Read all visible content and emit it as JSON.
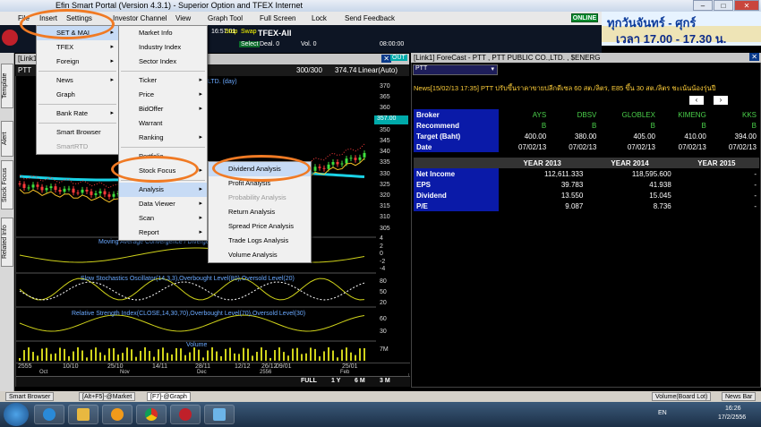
{
  "window": {
    "title": "Efin Smart Portal (Version 4.3.1) - Superior Option and TFEX Internet"
  },
  "menubar": {
    "items": [
      "File",
      "Insert",
      "Settings",
      "Investor Channel",
      "View",
      "Graph Tool",
      "Full Screen",
      "Lock",
      "Send Feedback"
    ],
    "online": "ONLINE"
  },
  "banner": {
    "line1": "ทุกวันจันทร์ - ศุกร์",
    "line2": "เวลา 17.00 - 17.30 น."
  },
  "ticker": {
    "time": "16:57:01",
    "stop": "Stop",
    "swap": "Swap",
    "symbol": "TFEX-All",
    "select": "Select",
    "deal": "Deal. 0",
    "vol": "Vol. 0",
    "clock": "08:00:00"
  },
  "menu_insert": {
    "items": [
      {
        "label": "SET & MAI",
        "arrow": true,
        "selected": true
      },
      {
        "label": "TFEX",
        "arrow": true
      },
      {
        "label": "Foreign",
        "arrow": true
      },
      {
        "label": "News",
        "arrow": true
      },
      {
        "label": "Graph",
        "arrow": false
      },
      {
        "label": "Bank Rate",
        "arrow": true
      },
      {
        "label": "Smart Browser",
        "arrow": false
      },
      {
        "label": "SmartRTD",
        "arrow": false,
        "disabled": true
      }
    ]
  },
  "menu_setmai": {
    "items": [
      {
        "label": "Market Info",
        "arrow": false
      },
      {
        "label": "Industry Index",
        "arrow": false
      },
      {
        "label": "Sector Index",
        "arrow": false
      },
      {
        "label": "Ticker",
        "arrow": true
      },
      {
        "label": "Price",
        "arrow": true
      },
      {
        "label": "BidOffer",
        "arrow": true
      },
      {
        "label": "Warrant",
        "arrow": false
      },
      {
        "label": "Ranking",
        "arrow": true
      },
      {
        "label": "Portfolio",
        "arrow": false
      },
      {
        "label": "Stock Focus",
        "arrow": true
      },
      {
        "label": "Analysis",
        "arrow": true,
        "selected": true
      },
      {
        "label": "Data Viewer",
        "arrow": true
      },
      {
        "label": "Scan",
        "arrow": true
      },
      {
        "label": "Report",
        "arrow": true
      }
    ]
  },
  "menu_analysis": {
    "items": [
      {
        "label": "Dividend Analysis",
        "selected": true
      },
      {
        "label": "Profit Analysis"
      },
      {
        "label": "Probability Analysis",
        "disabled": true
      },
      {
        "label": "Return Analysis"
      },
      {
        "label": "Spread Price Analysis"
      },
      {
        "label": "Trade Logs Analysis"
      },
      {
        "label": "Volume Analysis"
      }
    ]
  },
  "sidetabs": [
    "Template",
    "Alert",
    "Stock Focus",
    "Related Info"
  ],
  "chart": {
    "header": "[Link1]",
    "symbol": "PTT",
    "counter": "300/300",
    "price": "374.74",
    "scale": "Linear(Auto)",
    "title_suffix": "LTD. (day)",
    "out": "OUT",
    "last_price": "357.00",
    "price_ticks": [
      "370",
      "365",
      "360",
      "355",
      "350",
      "345",
      "340",
      "335",
      "330",
      "325",
      "320",
      "315",
      "310",
      "305"
    ],
    "macd_label": "Moving Average Convergence / Divergence",
    "macd_ticks": [
      "4",
      "2",
      "0",
      "-2",
      "-4"
    ],
    "stoch_label": "Slow Stochastics Oscillator(14,3,3),Overbought Level(80),Oversold Level(20)",
    "stoch_ticks": [
      "80",
      "50",
      "20"
    ],
    "rsi_label": "Relative Strength Index(CLOSE,14,30,70),Overbought Level(70),Oversold Level(30)",
    "rsi_ticks": [
      "60",
      "30"
    ],
    "volume_label": "Volume",
    "volume_tick": "7M",
    "dates_top": [
      "2555",
      "10/10",
      "25/10",
      "14/11",
      "28/11",
      "12/12",
      "26/12",
      "09/01",
      "25/01"
    ],
    "dates_bottom": [
      "Oct",
      "Nov",
      "Dec",
      "2556",
      "Feb"
    ],
    "periods": [
      "FULL",
      "1 Y",
      "6 M",
      "3 M"
    ]
  },
  "forecast": {
    "header": "[Link1] ForeCast - PTT , PTT PUBLIC CO.,LTD. , $ENERG",
    "symbol": "PTT",
    "news": "News[15/02/13  17:35]  PTT ปรับขึ้นราคาขายปลีกดีเซล 60 สต./ลิตร, E85 ขึ้น 30 สต./ลิตร ชะเน้นน้องรุ่นปี",
    "brokers": [
      "AYS",
      "DBSV",
      "GLOBLEX",
      "KIMENG",
      "KKS"
    ],
    "recommend": [
      "B",
      "B",
      "B",
      "B",
      "B"
    ],
    "target": [
      "400.00",
      "380.00",
      "405.00",
      "410.00",
      "394.00"
    ],
    "date": [
      "07/02/13",
      "07/02/13",
      "07/02/13",
      "07/02/13",
      "07/02/13"
    ],
    "row_labels": [
      "Broker",
      "Recommend",
      "Target (Baht)",
      "Date"
    ],
    "years": [
      "YEAR 2013",
      "YEAR 2014",
      "YEAR 2015"
    ],
    "fin_rows": [
      {
        "label": "Net Income",
        "values": [
          "112,611.333",
          "118,595.600",
          "-"
        ]
      },
      {
        "label": "EPS",
        "values": [
          "39.783",
          "41.938",
          "-"
        ]
      },
      {
        "label": "Dividend",
        "values": [
          "13.550",
          "15.045",
          "-"
        ]
      },
      {
        "label": "P/E",
        "values": [
          "9.087",
          "8.736",
          "-"
        ]
      }
    ]
  },
  "statusbar": {
    "tabs": [
      "Smart Browser",
      "[Alt+F5]-@Market",
      "[F7]-@Graph"
    ],
    "right1": "Volume(Board Lot)",
    "right2": "News Bar"
  },
  "taskbar": {
    "lang": "EN",
    "time": "16:26",
    "date": "17/2/2556"
  },
  "colors": {
    "orange_highlight": "#f07a24",
    "broker_blue": "#0a1aa8",
    "menu_select": "#c7dbf5"
  }
}
